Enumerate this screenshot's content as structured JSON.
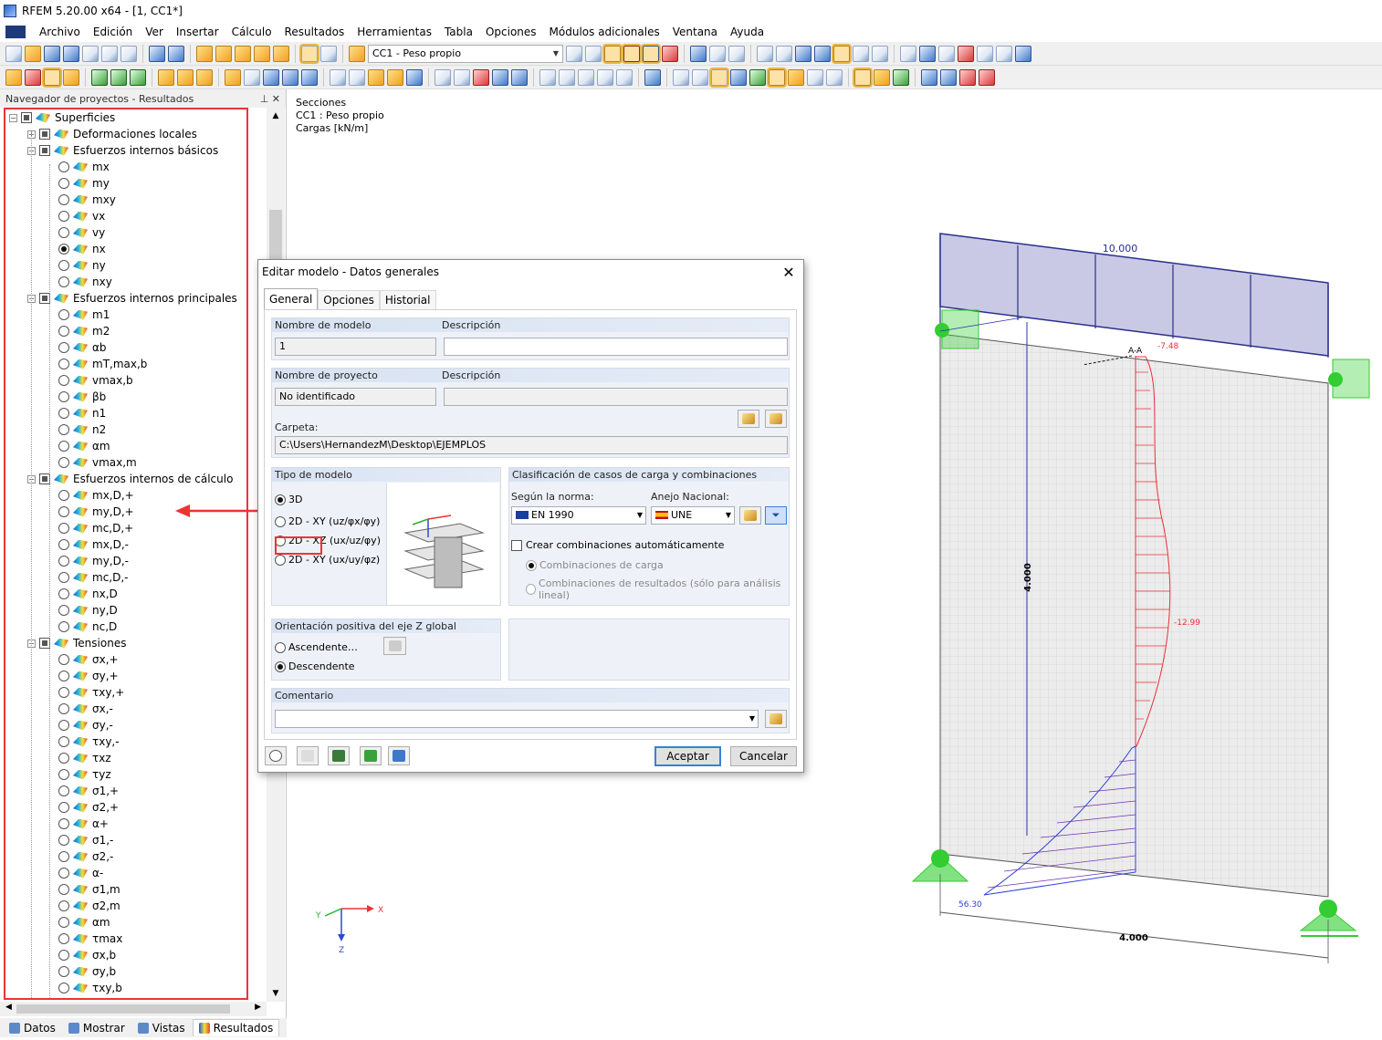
{
  "window": {
    "title": "RFEM 5.20.00 x64 - [1, CC1*]"
  },
  "menu": [
    "Archivo",
    "Edición",
    "Ver",
    "Insertar",
    "Cálculo",
    "Resultados",
    "Herramientas",
    "Tabla",
    "Opciones",
    "Módulos adicionales",
    "Ventana",
    "Ayuda"
  ],
  "toolbar": {
    "load_case": "CC1 - Peso propio"
  },
  "navigator": {
    "title": "Navegador de proyectos - Resultados",
    "items": [
      {
        "label": "Superficies",
        "level": 0,
        "type": "group"
      },
      {
        "label": "Deformaciones locales",
        "level": 1,
        "type": "group",
        "collapsed": true
      },
      {
        "label": "Esfuerzos internos básicos",
        "level": 1,
        "type": "group"
      },
      {
        "label": "mx",
        "level": 2,
        "type": "radio"
      },
      {
        "label": "my",
        "level": 2,
        "type": "radio"
      },
      {
        "label": "mxy",
        "level": 2,
        "type": "radio"
      },
      {
        "label": "vx",
        "level": 2,
        "type": "radio"
      },
      {
        "label": "vy",
        "level": 2,
        "type": "radio"
      },
      {
        "label": "nx",
        "level": 2,
        "type": "radio",
        "selected": true
      },
      {
        "label": "ny",
        "level": 2,
        "type": "radio"
      },
      {
        "label": "nxy",
        "level": 2,
        "type": "radio"
      },
      {
        "label": "Esfuerzos internos principales",
        "level": 1,
        "type": "group"
      },
      {
        "label": "m1",
        "level": 2,
        "type": "radio"
      },
      {
        "label": "m2",
        "level": 2,
        "type": "radio"
      },
      {
        "label": "αb",
        "level": 2,
        "type": "radio"
      },
      {
        "label": "mT,max,b",
        "level": 2,
        "type": "radio"
      },
      {
        "label": "vmax,b",
        "level": 2,
        "type": "radio"
      },
      {
        "label": "βb",
        "level": 2,
        "type": "radio"
      },
      {
        "label": "n1",
        "level": 2,
        "type": "radio"
      },
      {
        "label": "n2",
        "level": 2,
        "type": "radio"
      },
      {
        "label": "αm",
        "level": 2,
        "type": "radio"
      },
      {
        "label": "vmax,m",
        "level": 2,
        "type": "radio"
      },
      {
        "label": "Esfuerzos internos de cálculo",
        "level": 1,
        "type": "group"
      },
      {
        "label": "mx,D,+",
        "level": 2,
        "type": "radio"
      },
      {
        "label": "my,D,+",
        "level": 2,
        "type": "radio"
      },
      {
        "label": "mc,D,+",
        "level": 2,
        "type": "radio"
      },
      {
        "label": "mx,D,-",
        "level": 2,
        "type": "radio"
      },
      {
        "label": "my,D,-",
        "level": 2,
        "type": "radio"
      },
      {
        "label": "mc,D,-",
        "level": 2,
        "type": "radio"
      },
      {
        "label": "nx,D",
        "level": 2,
        "type": "radio"
      },
      {
        "label": "ny,D",
        "level": 2,
        "type": "radio"
      },
      {
        "label": "nc,D",
        "level": 2,
        "type": "radio"
      },
      {
        "label": "Tensiones",
        "level": 1,
        "type": "group"
      },
      {
        "label": "σx,+",
        "level": 2,
        "type": "radio"
      },
      {
        "label": "σy,+",
        "level": 2,
        "type": "radio"
      },
      {
        "label": "τxy,+",
        "level": 2,
        "type": "radio"
      },
      {
        "label": "σx,-",
        "level": 2,
        "type": "radio"
      },
      {
        "label": "σy,-",
        "level": 2,
        "type": "radio"
      },
      {
        "label": "τxy,-",
        "level": 2,
        "type": "radio"
      },
      {
        "label": "τxz",
        "level": 2,
        "type": "radio"
      },
      {
        "label": "τyz",
        "level": 2,
        "type": "radio"
      },
      {
        "label": "σ1,+",
        "level": 2,
        "type": "radio"
      },
      {
        "label": "σ2,+",
        "level": 2,
        "type": "radio"
      },
      {
        "label": "α+",
        "level": 2,
        "type": "radio"
      },
      {
        "label": "σ1,-",
        "level": 2,
        "type": "radio"
      },
      {
        "label": "σ2,-",
        "level": 2,
        "type": "radio"
      },
      {
        "label": "α-",
        "level": 2,
        "type": "radio"
      },
      {
        "label": "σ1,m",
        "level": 2,
        "type": "radio"
      },
      {
        "label": "σ2,m",
        "level": 2,
        "type": "radio"
      },
      {
        "label": "αm",
        "level": 2,
        "type": "radio"
      },
      {
        "label": "τmax",
        "level": 2,
        "type": "radio"
      },
      {
        "label": "σx,b",
        "level": 2,
        "type": "radio"
      },
      {
        "label": "σy,b",
        "level": 2,
        "type": "radio"
      },
      {
        "label": "τxy,b",
        "level": 2,
        "type": "radio"
      }
    ],
    "tabs": [
      "Datos",
      "Mostrar",
      "Vistas",
      "Resultados"
    ]
  },
  "view_info": {
    "line1": "Secciones",
    "line2": "CC1 : Peso propio",
    "line3": "Cargas [kN/m]"
  },
  "dialog": {
    "title": "Editar modelo - Datos generales",
    "tabs": [
      "General",
      "Opciones",
      "Historial"
    ],
    "model_name_label": "Nombre de modelo",
    "model_desc_label": "Descripción",
    "model_name": "1",
    "model_desc": "",
    "project_name_label": "Nombre de proyecto",
    "project_desc_label": "Descripción",
    "project_name": "No identificado",
    "project_desc": "",
    "folder_label": "Carpeta:",
    "folder": "C:\\Users\\HernandezM\\Desktop\\EJEMPLOS",
    "model_type_label": "Tipo de modelo",
    "model_types": [
      "3D",
      "2D - XY (uz/φx/φy)",
      "2D - XZ (ux/uz/φy)",
      "2D - XY (ux/uy/φz)"
    ],
    "model_type_selected": 0,
    "classification_label": "Clasificación de casos de carga y combinaciones",
    "norm_label": "Según la norma:",
    "norm_value": "EN 1990",
    "annex_label": "Anejo Nacional:",
    "annex_value": "UNE",
    "auto_comb_label": "Crear combinaciones automáticamente",
    "comb_load_label": "Combinaciones de carga",
    "comb_result_label": "Combinaciones de resultados (sólo para análisis lineal)",
    "z_axis_label": "Orientación positiva del eje Z global",
    "z_up_label": "Ascendente…",
    "z_down_label": "Descendente",
    "comment_label": "Comentario",
    "comment_value": "",
    "ok_label": "Aceptar",
    "cancel_label": "Cancelar"
  },
  "model3d": {
    "load_value": "10.000",
    "section_label": "A-A",
    "top_value": "-7.48",
    "mid_value": "-12.99",
    "bottom_value": "56.30",
    "height_dim": "4.000",
    "width_dim": "4.000",
    "axis_x": "X",
    "axis_y": "Y",
    "axis_z": "Z"
  },
  "colors": {
    "highlight": "#e33333",
    "load": "#2a2f8a",
    "support": "#33cc33",
    "diagram_neg": "#e8303a",
    "diagram_pos": "#3040d8"
  }
}
